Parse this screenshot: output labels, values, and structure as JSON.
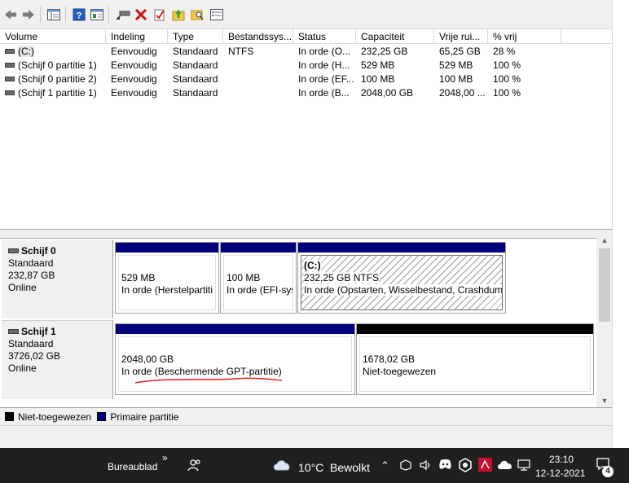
{
  "toolbar": {
    "icons": [
      "back-arrow-icon",
      "forward-arrow-icon",
      "show-console-tree-icon",
      "help-icon",
      "properties-icon",
      "connect-disk-icon",
      "delete-icon",
      "check-icon",
      "folder-up-icon",
      "search-folder-icon",
      "list-icon"
    ]
  },
  "list": {
    "columns": [
      "Volume",
      "Indeling",
      "Type",
      "Bestandssys...",
      "Status",
      "Capaciteit",
      "Vrije rui...",
      "% vrij"
    ],
    "rows": [
      [
        "(C:)",
        "Eenvoudig",
        "Standaard",
        "NTFS",
        "In orde (O...",
        "232,25 GB",
        "65,25 GB",
        "28 %"
      ],
      [
        "(Schijf 0 partitie 1)",
        "Eenvoudig",
        "Standaard",
        "",
        "In orde (H...",
        "529 MB",
        "529 MB",
        "100 %"
      ],
      [
        "(Schijf 0 partitie 2)",
        "Eenvoudig",
        "Standaard",
        "",
        "In orde (EF...",
        "100 MB",
        "100 MB",
        "100 %"
      ],
      [
        "(Schijf 1 partitie 1)",
        "Eenvoudig",
        "Standaard",
        "",
        "In orde (B...",
        "2048,00 GB",
        "2048,00 ...",
        "100 %"
      ]
    ]
  },
  "disks": [
    {
      "name": "Schijf 0",
      "type": "Standaard",
      "size": "232,87 GB",
      "state": "Online",
      "partitions": [
        {
          "name": "",
          "size": "529 MB",
          "status": "In orde (Herstelpartiti"
        },
        {
          "name": "",
          "size": "100 MB",
          "status": "In orde (EFI-sys"
        },
        {
          "name": "(C:)",
          "size": "232,25 GB NTFS",
          "status": "In orde (Opstarten, Wisselbestand, Crashdump"
        }
      ]
    },
    {
      "name": "Schijf 1",
      "type": "Standaard",
      "size": "3726,02 GB",
      "state": "Online",
      "partitions": [
        {
          "name": "",
          "size": "2048,00 GB",
          "status": "In orde (Beschermende GPT-partitie)"
        },
        {
          "name": "",
          "size": "1678,02 GB",
          "status": "Niet-toegewezen"
        }
      ]
    }
  ],
  "legend": {
    "unallocated": "Niet-toegewezen",
    "primary": "Primaire partitie"
  },
  "colors": {
    "primary_bar": "#00007f",
    "unallocated_bar": "#000000",
    "annotation": "#e02020",
    "taskbar": "#202020"
  },
  "taskbar": {
    "desktop_label": "Bureaublad",
    "chevron": "»",
    "temperature": "10°C",
    "weather": "Bewolkt",
    "time": "23:10",
    "date": "12-12-2021",
    "notification_count": "4"
  }
}
